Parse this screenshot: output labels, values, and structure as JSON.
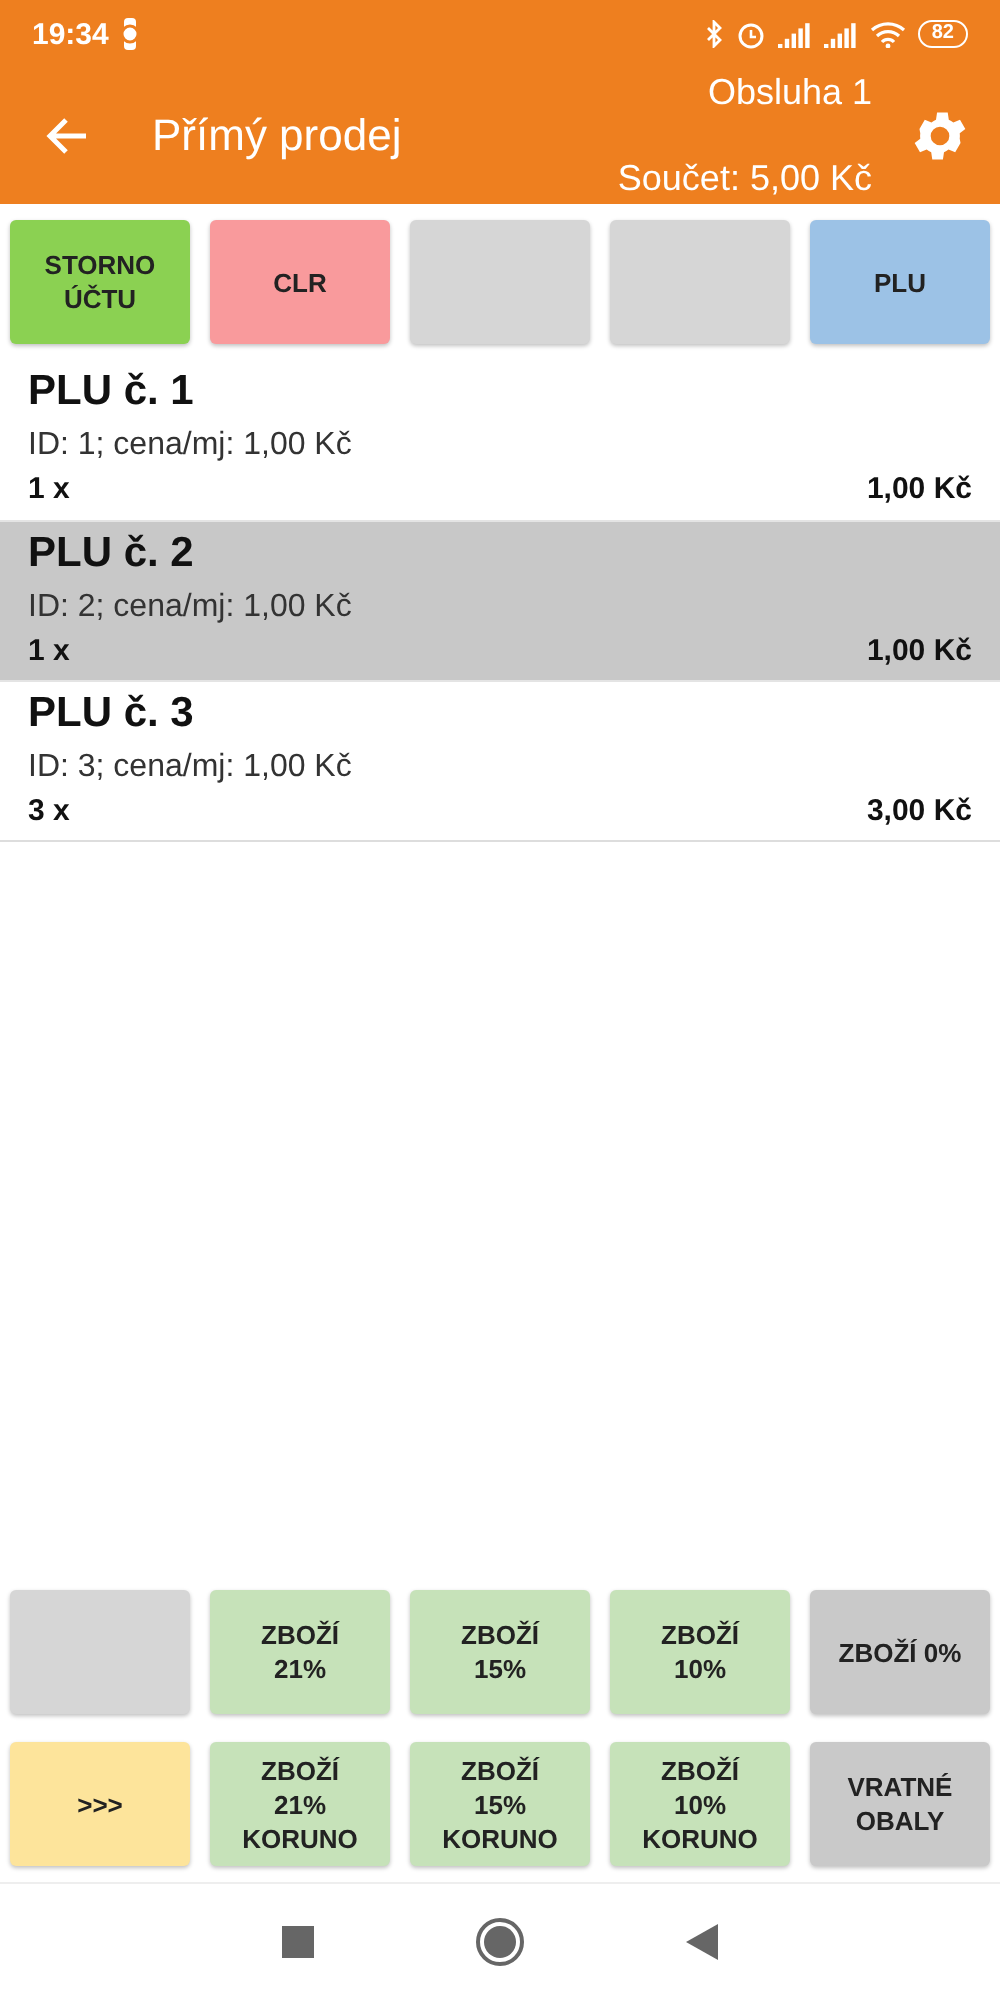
{
  "status_bar": {
    "time": "19:34",
    "battery": "82"
  },
  "app_bar": {
    "title": "Přímý prodej",
    "operator": "Obsluha 1",
    "total": "Součet: 5,00 Kč"
  },
  "top_buttons": [
    {
      "label": "STORNO\nÚČTU",
      "color": "#8bd152"
    },
    {
      "label": "CLR",
      "color": "#f99a9c"
    },
    {
      "color": "#d6d6d6"
    },
    {
      "color": "#d6d6d6"
    },
    {
      "label": "PLU",
      "color": "#9cc2e6"
    }
  ],
  "items": [
    {
      "name": "PLU č. 1",
      "detail": "ID: 1; cena/mj: 1,00 Kč",
      "quantity": "1 x",
      "amount": "1,00 Kč",
      "selected": false
    },
    {
      "name": "PLU č. 2",
      "detail": "ID: 2; cena/mj: 1,00 Kč",
      "quantity": "1 x",
      "amount": "1,00 Kč",
      "selected": true
    },
    {
      "name": "PLU č. 3",
      "detail": "ID: 3; cena/mj: 1,00 Kč",
      "quantity": "3 x",
      "amount": "3,00 Kč",
      "selected": false
    }
  ],
  "bottom_buttons": [
    [
      {
        "color": "#d6d6d6"
      },
      {
        "label": "ZBOŽÍ\n21%",
        "color": "#c6e2b9"
      },
      {
        "label": "ZBOŽÍ\n15%",
        "color": "#c6e2b9"
      },
      {
        "label": "ZBOŽÍ\n10%",
        "color": "#c6e2b9"
      },
      {
        "label": "ZBOŽÍ 0%",
        "color": "#c9c9c9"
      }
    ],
    [
      {
        "label": ">>>",
        "color": "#fde49b"
      },
      {
        "label": "ZBOŽÍ\n21%\nKORUNO",
        "color": "#c6e2b9"
      },
      {
        "label": "ZBOŽÍ\n15%\nKORUNO",
        "color": "#c6e2b9"
      },
      {
        "label": "ZBOŽÍ\n10%\nKORUNO",
        "color": "#c6e2b9"
      },
      {
        "label": "VRATNÉ\nOBALY",
        "color": "#c9c9c9"
      }
    ]
  ]
}
